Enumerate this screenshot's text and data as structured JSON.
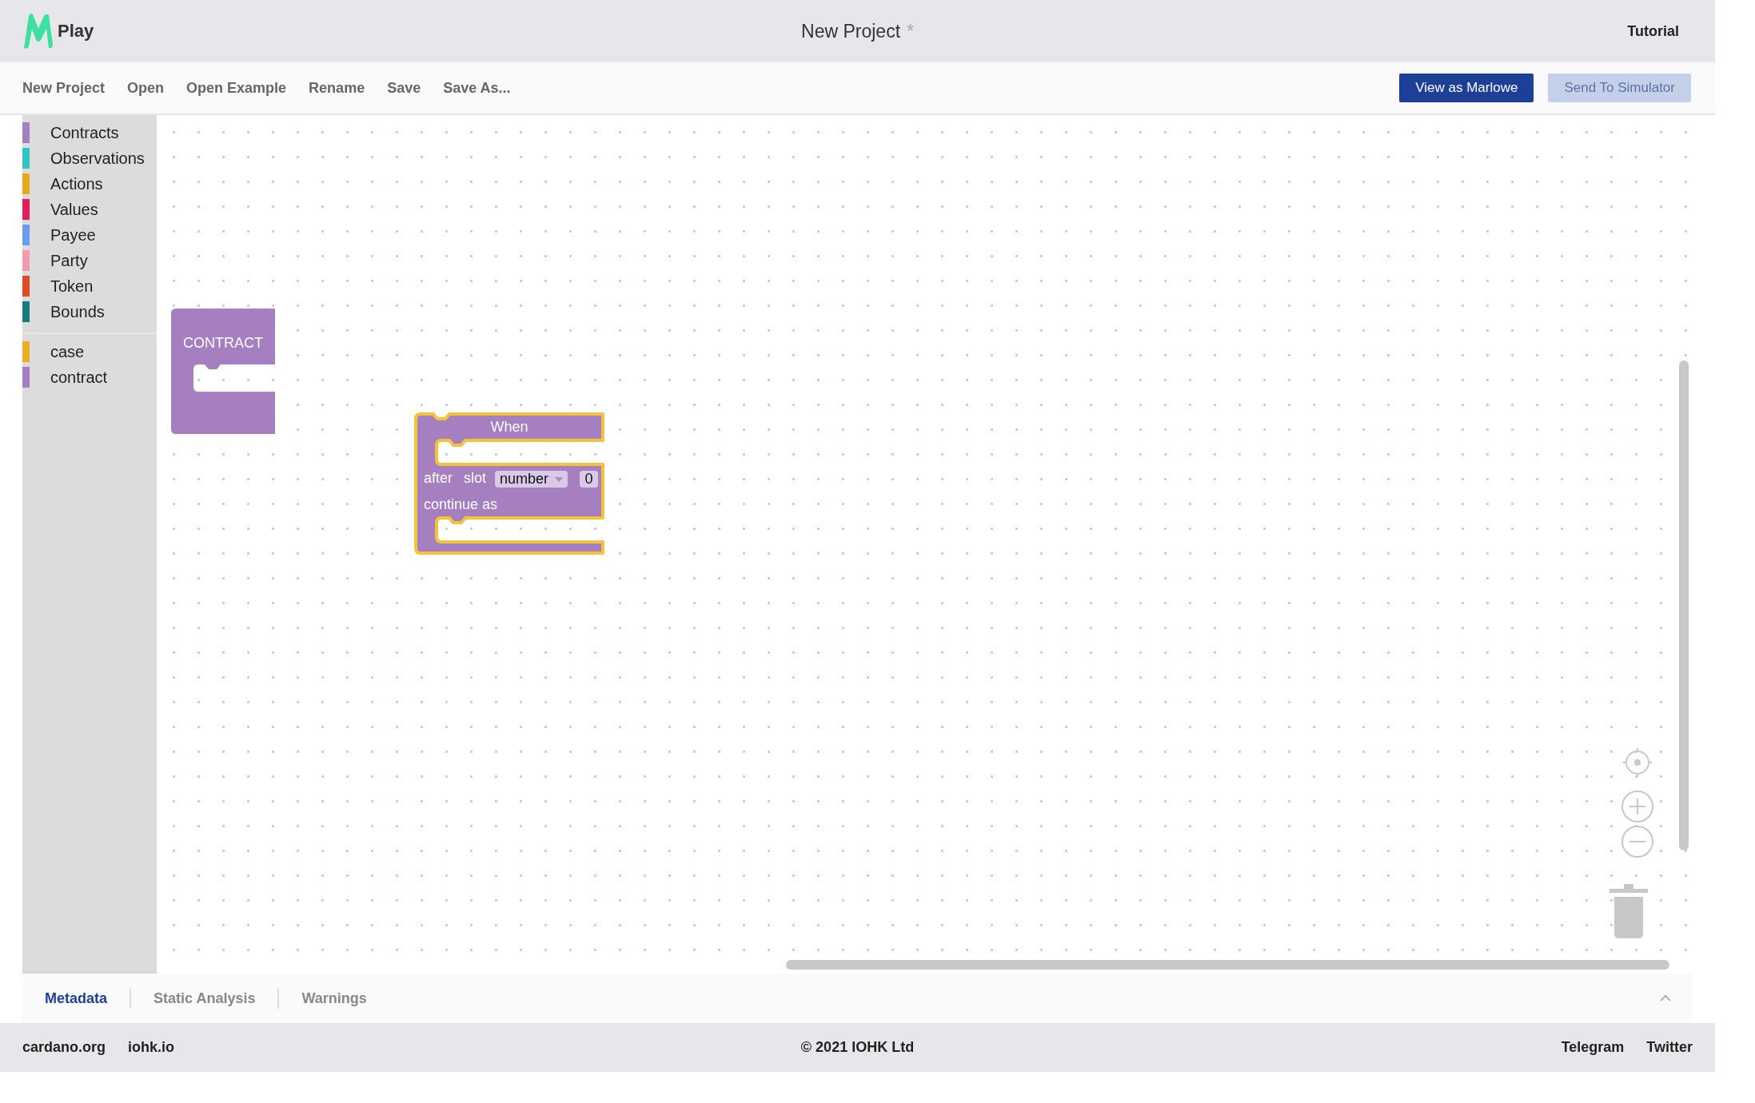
{
  "header": {
    "app_name": "Play",
    "title": "New Project",
    "unsaved_mark": "*",
    "tutorial": "Tutorial"
  },
  "toolbar": {
    "items": [
      "New Project",
      "Open",
      "Open Example",
      "Rename",
      "Save",
      "Save As..."
    ],
    "buttons": [
      {
        "label": "View as Marlowe",
        "disabled": false
      },
      {
        "label": "Send To Simulator",
        "disabled": true
      }
    ]
  },
  "sidebar": {
    "groups": [
      {
        "items": [
          {
            "label": "Contracts",
            "color": "#a57fc0"
          },
          {
            "label": "Observations",
            "color": "#2ec4c1"
          },
          {
            "label": "Actions",
            "color": "#e8a81e"
          },
          {
            "label": "Values",
            "color": "#e0205a"
          },
          {
            "label": "Payee",
            "color": "#6c9cf0"
          },
          {
            "label": "Party",
            "color": "#f39ab0"
          },
          {
            "label": "Token",
            "color": "#e04a26"
          },
          {
            "label": "Bounds",
            "color": "#1b7a7e"
          }
        ]
      },
      {
        "items": [
          {
            "label": "case",
            "color": "#e8b020"
          },
          {
            "label": "contract",
            "color": "#a57fc0"
          }
        ]
      }
    ]
  },
  "blocks": [
    {
      "kind": "contract",
      "label": "CONTRACT",
      "selected": false
    },
    {
      "kind": "when",
      "title": "When",
      "after": "after",
      "slot": "slot",
      "dropdown": "number",
      "value": "0",
      "continue": "continue as",
      "selected": true
    }
  ],
  "bottom_tabs": [
    {
      "label": "Metadata",
      "selected": true
    },
    {
      "label": "Static Analysis",
      "selected": false
    },
    {
      "label": "Warnings",
      "selected": false
    }
  ],
  "footer": {
    "left": [
      "cardano.org",
      "iohk.io"
    ],
    "center": "© 2021 IOHK Ltd",
    "right": [
      "Telegram",
      "Twitter"
    ]
  }
}
